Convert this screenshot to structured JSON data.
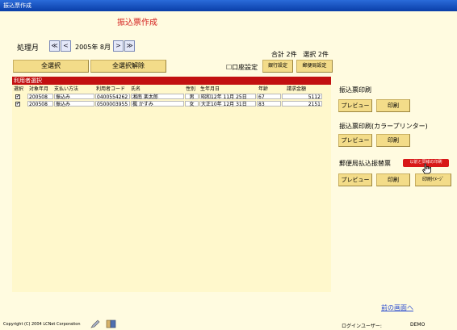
{
  "window": {
    "title": "振込票作成"
  },
  "header": {
    "title": "振込票作成"
  },
  "period": {
    "label": "処理月",
    "value": "2005年 8月",
    "nav": [
      "≪",
      "<",
      ">",
      "≫"
    ]
  },
  "summary": {
    "total": "合計 2件",
    "selected": "選択 2件"
  },
  "buttons": {
    "select_all": "全選択",
    "deselect_all": "全選択解除",
    "account_setting": "口座設定",
    "bank_setting": "銀行設定",
    "post_setting": "郵便局設定"
  },
  "list": {
    "title": "利用者選択",
    "columns": [
      "選択",
      "対象年月",
      "支払い方法",
      "利用者コード",
      "氏名",
      "性別",
      "生年月日",
      "年齢",
      "請求金額"
    ],
    "rows": [
      {
        "checked": "✔",
        "ym": "200508",
        "method": "振込み",
        "code": "0400554262",
        "name": "湘南 楽太郎",
        "sex": "男",
        "birth": "昭和12年 11月 25日",
        "age": "67",
        "amount": "5112"
      },
      {
        "checked": "✔",
        "ym": "200508",
        "method": "振込み",
        "code": "0500003955",
        "name": "楓 かすみ",
        "sex": "女",
        "birth": "大正10年 12月 31日",
        "age": "83",
        "amount": "2151"
      }
    ]
  },
  "right": {
    "section1": "振込票印刷",
    "section2": "振込票印刷(カラープリンター)",
    "section3": "郵便局払込振替票",
    "preview": "プレビュー",
    "print": "印刷",
    "print_image": "印刷ｲﾒｰｼﾞ",
    "red_tag": "以前と同様の印刷",
    "back": "前の画面へ"
  },
  "footer": {
    "copyright": "Copyright (C) 2004 LCNet Corporation",
    "user_label": "ログインユーザー:",
    "user_value": "DEMO"
  },
  "colors": {
    "title_red": "#d4201e",
    "header_red": "#c21010",
    "button": "#f3dc89",
    "background": "#fffbe0"
  }
}
